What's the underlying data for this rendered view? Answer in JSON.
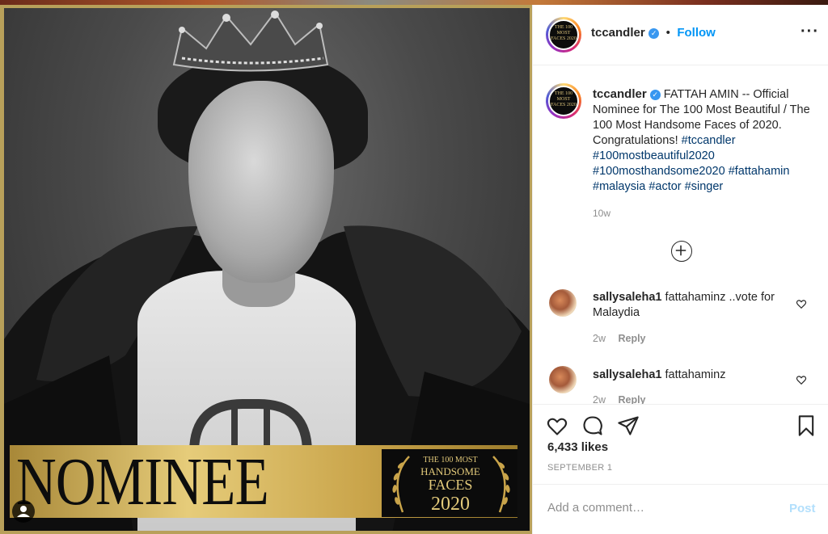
{
  "post": {
    "image": {
      "banner_text": "NOMINEE",
      "badge": {
        "line1": "THE 100 MOST",
        "line2": "HANDSOME",
        "line3": "FACES",
        "line4": "2020"
      }
    },
    "header": {
      "username": "tccandler",
      "separator": "•",
      "follow_label": "Follow",
      "more_icon": "more-options-icon",
      "avatar_text": "THE 100 MOST FACES 2020"
    },
    "caption": {
      "username": "tccandler",
      "text": "FATTAH AMIN -- Official Nominee for The 100 Most Beautiful / The 100 Most Handsome Faces of 2020. Congratulations!",
      "hashtags": [
        "#tccandler",
        "#100mostbeautiful2020",
        "#100mosthandsome2020",
        "#fattahamin",
        "#malaysia",
        "#actor",
        "#singer"
      ],
      "time": "10w"
    },
    "comments": [
      {
        "username": "sallysaleha1",
        "text": "fattahaminz ..vote for Malaydia",
        "time": "2w",
        "reply_label": "Reply"
      },
      {
        "username": "sallysaleha1",
        "text": "fattahaminz",
        "time": "2w",
        "reply_label": "Reply"
      }
    ],
    "actions": {
      "likes": "6,433 likes",
      "date": "SEPTEMBER 1",
      "comment_placeholder": "Add a comment…",
      "post_label": "Post"
    }
  },
  "colors": {
    "link_blue": "#0095f6",
    "hashtag_blue": "#00376b",
    "muted": "#8e8e8e",
    "gold": "#c9a44a"
  }
}
